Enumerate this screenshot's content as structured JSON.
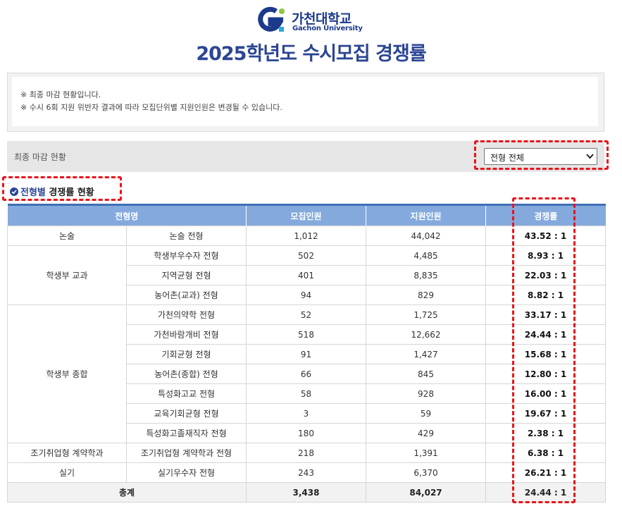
{
  "header": {
    "logo_text_ko": "가천대학교",
    "logo_text_en": "Gachon University",
    "title": "2025학년도  수시모집  경쟁률"
  },
  "notice": {
    "lines": [
      "※ 최종 마감 현황입니다.",
      "※ 수시 6회 지원 위반자 결과에 따라 모집단위별 지원인원은 변경될 수 있습니다."
    ]
  },
  "filter": {
    "label": "최종 마감 현황",
    "selected": "전형 전체"
  },
  "section": {
    "title_part1": "전형별",
    "title_part2": " 경쟁률 현황"
  },
  "table": {
    "headers": [
      "전형명",
      "모집인원",
      "지원인원",
      "경쟁률"
    ],
    "groups": [
      "논술",
      "학생부 교과",
      "학생부 종합",
      "조기취업형 계약학과",
      "실기"
    ],
    "rows": [
      [
        "논술 전형",
        "1,012",
        "44,042",
        "43.52 : 1"
      ],
      [
        "학생부우수자 전형",
        "502",
        "4,485",
        "8.93 : 1"
      ],
      [
        "지역균형 전형",
        "401",
        "8,835",
        "22.03 : 1"
      ],
      [
        "농어촌(교과) 전형",
        "94",
        "829",
        "8.82 : 1"
      ],
      [
        "가천의약학 전형",
        "52",
        "1,725",
        "33.17 : 1"
      ],
      [
        "가천바람개비 전형",
        "518",
        "12,662",
        "24.44 : 1"
      ],
      [
        "기회균형 전형",
        "91",
        "1,427",
        "15.68 : 1"
      ],
      [
        "농어촌(종합) 전형",
        "66",
        "845",
        "12.80 : 1"
      ],
      [
        "특성화고교 전형",
        "58",
        "928",
        "16.00 : 1"
      ],
      [
        "교육기회균형 전형",
        "3",
        "59",
        "19.67 : 1"
      ],
      [
        "특성화고졸재직자 전형",
        "180",
        "429",
        "2.38 : 1"
      ],
      [
        "조기취업형 계약학과 전형",
        "218",
        "1,391",
        "6.38 : 1"
      ],
      [
        "실기우수자 전형",
        "243",
        "6,370",
        "26.21 : 1"
      ]
    ],
    "total": [
      "총계",
      "3,438",
      "84,027",
      "24.44 : 1"
    ]
  },
  "colors": {
    "brand_blue": "#2c4594",
    "header_blue": "#84aadd",
    "annotation_red": "#e8141b",
    "logo_green": "#8cc63f"
  }
}
